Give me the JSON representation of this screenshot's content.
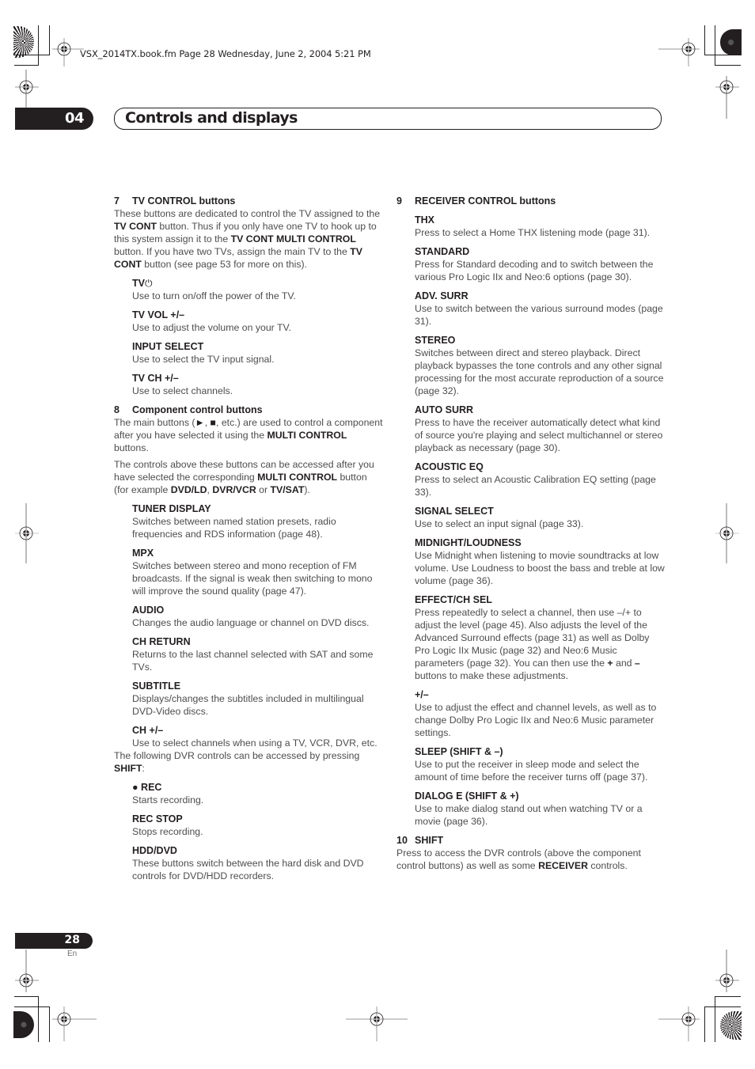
{
  "file_info": "VSX_2014TX.book.fm  Page 28  Wednesday, June 2, 2004  5:21 PM",
  "chapter": {
    "number": "04",
    "title": "Controls and displays"
  },
  "left_column": {
    "sec7": {
      "num": "7",
      "title": "TV CONTROL buttons",
      "intro_parts": [
        "These buttons are dedicated to control the TV assigned to the ",
        "TV CONT",
        " button. Thus if you only have one TV to hook up to this system assign it to the ",
        "TV CONT MULTI CONTROL",
        " button. If you have two TVs, assign the main TV to the ",
        "TV CONT",
        " button (see page 53 for more on this)."
      ],
      "items": [
        {
          "title": "TV",
          "icon": "power-icon",
          "desc": "Use to turn on/off the power of the TV."
        },
        {
          "title": "TV VOL +/–",
          "desc": "Use to adjust the volume on your TV."
        },
        {
          "title": "INPUT SELECT",
          "desc": "Use to select the TV input signal."
        },
        {
          "title": "TV CH +/–",
          "desc": "Use to select channels."
        }
      ]
    },
    "sec8": {
      "num": "8",
      "title": "Component control buttons",
      "intro1_parts": [
        "The main buttons (",
        "►",
        ", ",
        "■",
        ", etc.) are used to control a component after you have selected it using the ",
        "MULTI CONTROL",
        " buttons."
      ],
      "intro2_parts": [
        "The controls above these buttons can be accessed after you have selected the corresponding ",
        "MULTI CONTROL",
        " button (for example ",
        "DVD/LD",
        ", ",
        "DVR/VCR",
        " or ",
        "TV/SAT",
        ")."
      ],
      "items": [
        {
          "title": "TUNER DISPLAY",
          "desc": "Switches between named station presets, radio frequencies and RDS information (page 48)."
        },
        {
          "title": "MPX",
          "desc": "Switches between stereo and mono reception of FM broadcasts. If the signal is weak then switching to mono will improve the sound quality (page 47)."
        },
        {
          "title": "AUDIO",
          "desc": "Changes the audio language or channel on DVD discs."
        },
        {
          "title": "CH RETURN",
          "desc": "Returns to the last channel selected with SAT and some TVs."
        },
        {
          "title": "SUBTITLE",
          "desc": "Displays/changes the subtitles included in multilingual DVD-Video discs."
        },
        {
          "title": "CH +/–",
          "desc": "Use to select channels when using a TV, VCR, DVR, etc."
        }
      ],
      "shift_note_parts": [
        "The following DVR controls can be accessed by pressing ",
        "SHIFT",
        ":"
      ],
      "shift_items": [
        {
          "title": "REC",
          "icon": "record-dot-icon",
          "icon_glyph": "●",
          "desc": "Starts recording."
        },
        {
          "title": "REC STOP",
          "desc": "Stops recording."
        },
        {
          "title": "HDD/DVD",
          "desc": "These buttons switch between the hard disk and DVD controls for DVD/HDD recorders."
        }
      ]
    }
  },
  "right_column": {
    "sec9": {
      "num": "9",
      "title": "RECEIVER CONTROL buttons",
      "items": [
        {
          "title": "THX",
          "desc": "Press to select a Home THX listening mode (page 31)."
        },
        {
          "title": "STANDARD",
          "desc": "Press for Standard decoding and to switch between the various Pro Logic IIx and Neo:6 options (page 30)."
        },
        {
          "title": "ADV. SURR",
          "desc": "Use to switch between the various surround modes (page 31)."
        },
        {
          "title": "STEREO",
          "desc": "Switches between direct and stereo playback. Direct playback bypasses the tone controls and any other signal processing for the most accurate reproduction of a source (page 32)."
        },
        {
          "title": "AUTO SURR",
          "desc": "Press to have the receiver automatically detect what kind of source you're playing and select multichannel or stereo playback as necessary (page 30)."
        },
        {
          "title": "ACOUSTIC EQ",
          "desc": "Press to select an Acoustic Calibration EQ setting (page 33)."
        },
        {
          "title": "SIGNAL SELECT",
          "desc": "Use to select an input signal (page 33)."
        },
        {
          "title": "MIDNIGHT/LOUDNESS",
          "desc": "Use Midnight when listening to movie soundtracks at low volume. Use Loudness to boost the bass and treble at low volume (page 36)."
        }
      ],
      "effect_item": {
        "title": "EFFECT/CH SEL",
        "desc_parts": [
          "Press repeatedly to select a channel, then use –/+ to adjust the level (page 45). Also adjusts the level of the Advanced Surround effects (page 31) as well as Dolby Pro Logic IIx Music (page 32) and Neo:6 Music parameters (page 32). You can then use the ",
          "+",
          " and ",
          "–",
          " buttons to make these adjustments."
        ]
      },
      "items2": [
        {
          "title": "+/–",
          "desc": "Use to adjust the effect and channel levels, as well as to change Dolby Pro Logic IIx and Neo:6 Music parameter settings."
        },
        {
          "title": "SLEEP (SHIFT & –)",
          "desc": "Use to put the receiver in sleep mode and select the amount of time before the receiver turns off (page 37)."
        },
        {
          "title": "DIALOG E (SHIFT & +)",
          "desc": "Use to make dialog stand out when watching TV or a movie (page 36)."
        }
      ]
    },
    "sec10": {
      "num": "10",
      "title": "SHIFT",
      "desc_parts": [
        "Press to access the DVR controls (above the component control buttons) as well as some ",
        "RECEIVER",
        " controls."
      ]
    }
  },
  "footer": {
    "page_number": "28",
    "language": "En"
  }
}
